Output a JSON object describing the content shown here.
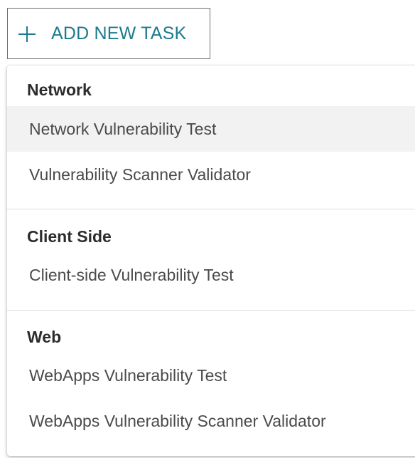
{
  "add_button": {
    "icon": "plus-icon",
    "label": "ADD NEW TASK",
    "color": "#1a7a8e"
  },
  "menu": {
    "groups": [
      {
        "header": "Network",
        "items": [
          {
            "label": "Network Vulnerability Test",
            "hovered": true
          },
          {
            "label": "Vulnerability Scanner Validator",
            "hovered": false
          }
        ]
      },
      {
        "header": "Client Side",
        "items": [
          {
            "label": "Client-side Vulnerability Test",
            "hovered": false
          }
        ]
      },
      {
        "header": "Web",
        "items": [
          {
            "label": "WebApps Vulnerability Test",
            "hovered": false
          },
          {
            "label": "WebApps Vulnerability Scanner Validator",
            "hovered": false
          }
        ]
      }
    ]
  }
}
